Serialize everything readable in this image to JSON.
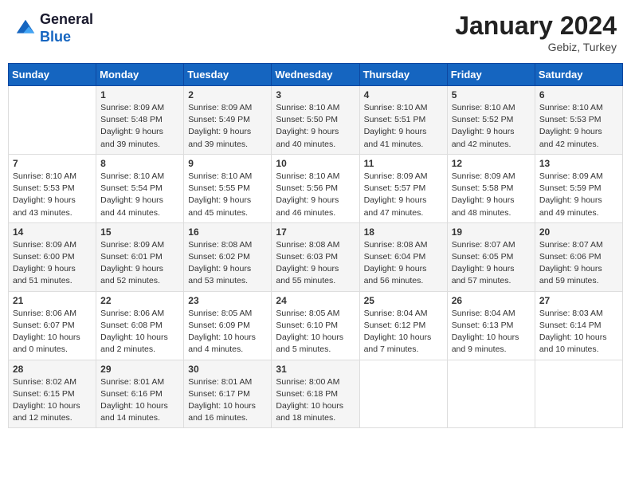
{
  "header": {
    "logo_line1": "General",
    "logo_line2": "Blue",
    "month": "January 2024",
    "location": "Gebiz, Turkey"
  },
  "days_of_week": [
    "Sunday",
    "Monday",
    "Tuesday",
    "Wednesday",
    "Thursday",
    "Friday",
    "Saturday"
  ],
  "weeks": [
    [
      {
        "num": "",
        "info": ""
      },
      {
        "num": "1",
        "info": "Sunrise: 8:09 AM\nSunset: 5:48 PM\nDaylight: 9 hours\nand 39 minutes."
      },
      {
        "num": "2",
        "info": "Sunrise: 8:09 AM\nSunset: 5:49 PM\nDaylight: 9 hours\nand 39 minutes."
      },
      {
        "num": "3",
        "info": "Sunrise: 8:10 AM\nSunset: 5:50 PM\nDaylight: 9 hours\nand 40 minutes."
      },
      {
        "num": "4",
        "info": "Sunrise: 8:10 AM\nSunset: 5:51 PM\nDaylight: 9 hours\nand 41 minutes."
      },
      {
        "num": "5",
        "info": "Sunrise: 8:10 AM\nSunset: 5:52 PM\nDaylight: 9 hours\nand 42 minutes."
      },
      {
        "num": "6",
        "info": "Sunrise: 8:10 AM\nSunset: 5:53 PM\nDaylight: 9 hours\nand 42 minutes."
      }
    ],
    [
      {
        "num": "7",
        "info": "Sunrise: 8:10 AM\nSunset: 5:53 PM\nDaylight: 9 hours\nand 43 minutes."
      },
      {
        "num": "8",
        "info": "Sunrise: 8:10 AM\nSunset: 5:54 PM\nDaylight: 9 hours\nand 44 minutes."
      },
      {
        "num": "9",
        "info": "Sunrise: 8:10 AM\nSunset: 5:55 PM\nDaylight: 9 hours\nand 45 minutes."
      },
      {
        "num": "10",
        "info": "Sunrise: 8:10 AM\nSunset: 5:56 PM\nDaylight: 9 hours\nand 46 minutes."
      },
      {
        "num": "11",
        "info": "Sunrise: 8:09 AM\nSunset: 5:57 PM\nDaylight: 9 hours\nand 47 minutes."
      },
      {
        "num": "12",
        "info": "Sunrise: 8:09 AM\nSunset: 5:58 PM\nDaylight: 9 hours\nand 48 minutes."
      },
      {
        "num": "13",
        "info": "Sunrise: 8:09 AM\nSunset: 5:59 PM\nDaylight: 9 hours\nand 49 minutes."
      }
    ],
    [
      {
        "num": "14",
        "info": "Sunrise: 8:09 AM\nSunset: 6:00 PM\nDaylight: 9 hours\nand 51 minutes."
      },
      {
        "num": "15",
        "info": "Sunrise: 8:09 AM\nSunset: 6:01 PM\nDaylight: 9 hours\nand 52 minutes."
      },
      {
        "num": "16",
        "info": "Sunrise: 8:08 AM\nSunset: 6:02 PM\nDaylight: 9 hours\nand 53 minutes."
      },
      {
        "num": "17",
        "info": "Sunrise: 8:08 AM\nSunset: 6:03 PM\nDaylight: 9 hours\nand 55 minutes."
      },
      {
        "num": "18",
        "info": "Sunrise: 8:08 AM\nSunset: 6:04 PM\nDaylight: 9 hours\nand 56 minutes."
      },
      {
        "num": "19",
        "info": "Sunrise: 8:07 AM\nSunset: 6:05 PM\nDaylight: 9 hours\nand 57 minutes."
      },
      {
        "num": "20",
        "info": "Sunrise: 8:07 AM\nSunset: 6:06 PM\nDaylight: 9 hours\nand 59 minutes."
      }
    ],
    [
      {
        "num": "21",
        "info": "Sunrise: 8:06 AM\nSunset: 6:07 PM\nDaylight: 10 hours\nand 0 minutes."
      },
      {
        "num": "22",
        "info": "Sunrise: 8:06 AM\nSunset: 6:08 PM\nDaylight: 10 hours\nand 2 minutes."
      },
      {
        "num": "23",
        "info": "Sunrise: 8:05 AM\nSunset: 6:09 PM\nDaylight: 10 hours\nand 4 minutes."
      },
      {
        "num": "24",
        "info": "Sunrise: 8:05 AM\nSunset: 6:10 PM\nDaylight: 10 hours\nand 5 minutes."
      },
      {
        "num": "25",
        "info": "Sunrise: 8:04 AM\nSunset: 6:12 PM\nDaylight: 10 hours\nand 7 minutes."
      },
      {
        "num": "26",
        "info": "Sunrise: 8:04 AM\nSunset: 6:13 PM\nDaylight: 10 hours\nand 9 minutes."
      },
      {
        "num": "27",
        "info": "Sunrise: 8:03 AM\nSunset: 6:14 PM\nDaylight: 10 hours\nand 10 minutes."
      }
    ],
    [
      {
        "num": "28",
        "info": "Sunrise: 8:02 AM\nSunset: 6:15 PM\nDaylight: 10 hours\nand 12 minutes."
      },
      {
        "num": "29",
        "info": "Sunrise: 8:01 AM\nSunset: 6:16 PM\nDaylight: 10 hours\nand 14 minutes."
      },
      {
        "num": "30",
        "info": "Sunrise: 8:01 AM\nSunset: 6:17 PM\nDaylight: 10 hours\nand 16 minutes."
      },
      {
        "num": "31",
        "info": "Sunrise: 8:00 AM\nSunset: 6:18 PM\nDaylight: 10 hours\nand 18 minutes."
      },
      {
        "num": "",
        "info": ""
      },
      {
        "num": "",
        "info": ""
      },
      {
        "num": "",
        "info": ""
      }
    ]
  ]
}
